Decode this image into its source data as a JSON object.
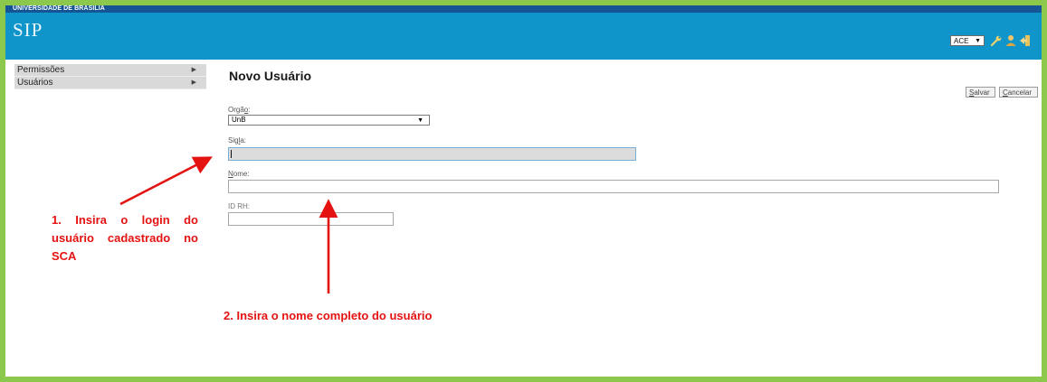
{
  "header": {
    "institution": "UNIVERSIDADE DE BRASILIA",
    "app_name": "SIP",
    "unit_selector": {
      "value": "ACE"
    },
    "icons": [
      "wrench-icon",
      "user-icon",
      "exit-icon"
    ],
    "colors": {
      "topbar": "#155596",
      "header": "#0f95ca"
    }
  },
  "sidebar": {
    "items": [
      {
        "label": "Permissões"
      },
      {
        "label": "Usuários"
      }
    ]
  },
  "main": {
    "title": "Novo Usuário",
    "buttons": {
      "save": {
        "underlined": "S",
        "rest": "alvar"
      },
      "cancel": {
        "underlined": "C",
        "rest": "ancelar"
      }
    },
    "form": {
      "orgao": {
        "label_pre": "Orgã",
        "label_underlined": "o",
        "label_post": ":",
        "value": "UnB"
      },
      "sigla": {
        "label_pre": "Sig",
        "label_underlined": "l",
        "label_post": "a:",
        "value": ""
      },
      "nome": {
        "label_underlined": "N",
        "label_post": "ome:",
        "value": ""
      },
      "id_rh": {
        "label": "ID RH:",
        "value": ""
      }
    }
  },
  "annotations": {
    "note1": "1. Insira o login do usuário cadastrado no SCA",
    "note2": "2. Insira o nome completo do usuário",
    "color": "#e51212"
  },
  "frame_color": "#8cc84b"
}
